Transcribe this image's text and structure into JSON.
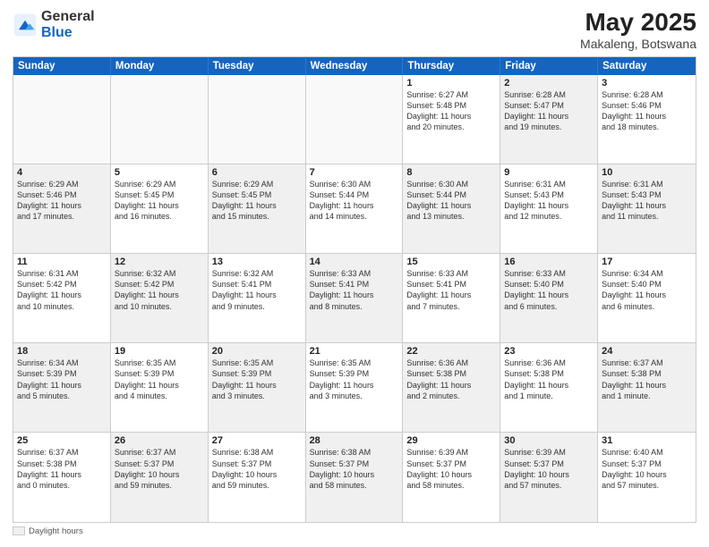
{
  "header": {
    "logo_general": "General",
    "logo_blue": "Blue",
    "month_year": "May 2025",
    "location": "Makaleng, Botswana"
  },
  "days_of_week": [
    "Sunday",
    "Monday",
    "Tuesday",
    "Wednesday",
    "Thursday",
    "Friday",
    "Saturday"
  ],
  "footer": {
    "label": "Daylight hours"
  },
  "weeks": [
    [
      {
        "day": "",
        "text": "",
        "empty": true
      },
      {
        "day": "",
        "text": "",
        "empty": true
      },
      {
        "day": "",
        "text": "",
        "empty": true
      },
      {
        "day": "",
        "text": "",
        "empty": true
      },
      {
        "day": "1",
        "text": "Sunrise: 6:27 AM\nSunset: 5:48 PM\nDaylight: 11 hours\nand 20 minutes.",
        "shaded": false
      },
      {
        "day": "2",
        "text": "Sunrise: 6:28 AM\nSunset: 5:47 PM\nDaylight: 11 hours\nand 19 minutes.",
        "shaded": true
      },
      {
        "day": "3",
        "text": "Sunrise: 6:28 AM\nSunset: 5:46 PM\nDaylight: 11 hours\nand 18 minutes.",
        "shaded": false
      }
    ],
    [
      {
        "day": "4",
        "text": "Sunrise: 6:29 AM\nSunset: 5:46 PM\nDaylight: 11 hours\nand 17 minutes.",
        "shaded": true
      },
      {
        "day": "5",
        "text": "Sunrise: 6:29 AM\nSunset: 5:45 PM\nDaylight: 11 hours\nand 16 minutes.",
        "shaded": false
      },
      {
        "day": "6",
        "text": "Sunrise: 6:29 AM\nSunset: 5:45 PM\nDaylight: 11 hours\nand 15 minutes.",
        "shaded": true
      },
      {
        "day": "7",
        "text": "Sunrise: 6:30 AM\nSunset: 5:44 PM\nDaylight: 11 hours\nand 14 minutes.",
        "shaded": false
      },
      {
        "day": "8",
        "text": "Sunrise: 6:30 AM\nSunset: 5:44 PM\nDaylight: 11 hours\nand 13 minutes.",
        "shaded": true
      },
      {
        "day": "9",
        "text": "Sunrise: 6:31 AM\nSunset: 5:43 PM\nDaylight: 11 hours\nand 12 minutes.",
        "shaded": false
      },
      {
        "day": "10",
        "text": "Sunrise: 6:31 AM\nSunset: 5:43 PM\nDaylight: 11 hours\nand 11 minutes.",
        "shaded": true
      }
    ],
    [
      {
        "day": "11",
        "text": "Sunrise: 6:31 AM\nSunset: 5:42 PM\nDaylight: 11 hours\nand 10 minutes.",
        "shaded": false
      },
      {
        "day": "12",
        "text": "Sunrise: 6:32 AM\nSunset: 5:42 PM\nDaylight: 11 hours\nand 10 minutes.",
        "shaded": true
      },
      {
        "day": "13",
        "text": "Sunrise: 6:32 AM\nSunset: 5:41 PM\nDaylight: 11 hours\nand 9 minutes.",
        "shaded": false
      },
      {
        "day": "14",
        "text": "Sunrise: 6:33 AM\nSunset: 5:41 PM\nDaylight: 11 hours\nand 8 minutes.",
        "shaded": true
      },
      {
        "day": "15",
        "text": "Sunrise: 6:33 AM\nSunset: 5:41 PM\nDaylight: 11 hours\nand 7 minutes.",
        "shaded": false
      },
      {
        "day": "16",
        "text": "Sunrise: 6:33 AM\nSunset: 5:40 PM\nDaylight: 11 hours\nand 6 minutes.",
        "shaded": true
      },
      {
        "day": "17",
        "text": "Sunrise: 6:34 AM\nSunset: 5:40 PM\nDaylight: 11 hours\nand 6 minutes.",
        "shaded": false
      }
    ],
    [
      {
        "day": "18",
        "text": "Sunrise: 6:34 AM\nSunset: 5:39 PM\nDaylight: 11 hours\nand 5 minutes.",
        "shaded": true
      },
      {
        "day": "19",
        "text": "Sunrise: 6:35 AM\nSunset: 5:39 PM\nDaylight: 11 hours\nand 4 minutes.",
        "shaded": false
      },
      {
        "day": "20",
        "text": "Sunrise: 6:35 AM\nSunset: 5:39 PM\nDaylight: 11 hours\nand 3 minutes.",
        "shaded": true
      },
      {
        "day": "21",
        "text": "Sunrise: 6:35 AM\nSunset: 5:39 PM\nDaylight: 11 hours\nand 3 minutes.",
        "shaded": false
      },
      {
        "day": "22",
        "text": "Sunrise: 6:36 AM\nSunset: 5:38 PM\nDaylight: 11 hours\nand 2 minutes.",
        "shaded": true
      },
      {
        "day": "23",
        "text": "Sunrise: 6:36 AM\nSunset: 5:38 PM\nDaylight: 11 hours\nand 1 minute.",
        "shaded": false
      },
      {
        "day": "24",
        "text": "Sunrise: 6:37 AM\nSunset: 5:38 PM\nDaylight: 11 hours\nand 1 minute.",
        "shaded": true
      }
    ],
    [
      {
        "day": "25",
        "text": "Sunrise: 6:37 AM\nSunset: 5:38 PM\nDaylight: 11 hours\nand 0 minutes.",
        "shaded": false
      },
      {
        "day": "26",
        "text": "Sunrise: 6:37 AM\nSunset: 5:37 PM\nDaylight: 10 hours\nand 59 minutes.",
        "shaded": true
      },
      {
        "day": "27",
        "text": "Sunrise: 6:38 AM\nSunset: 5:37 PM\nDaylight: 10 hours\nand 59 minutes.",
        "shaded": false
      },
      {
        "day": "28",
        "text": "Sunrise: 6:38 AM\nSunset: 5:37 PM\nDaylight: 10 hours\nand 58 minutes.",
        "shaded": true
      },
      {
        "day": "29",
        "text": "Sunrise: 6:39 AM\nSunset: 5:37 PM\nDaylight: 10 hours\nand 58 minutes.",
        "shaded": false
      },
      {
        "day": "30",
        "text": "Sunrise: 6:39 AM\nSunset: 5:37 PM\nDaylight: 10 hours\nand 57 minutes.",
        "shaded": true
      },
      {
        "day": "31",
        "text": "Sunrise: 6:40 AM\nSunset: 5:37 PM\nDaylight: 10 hours\nand 57 minutes.",
        "shaded": false
      }
    ]
  ]
}
